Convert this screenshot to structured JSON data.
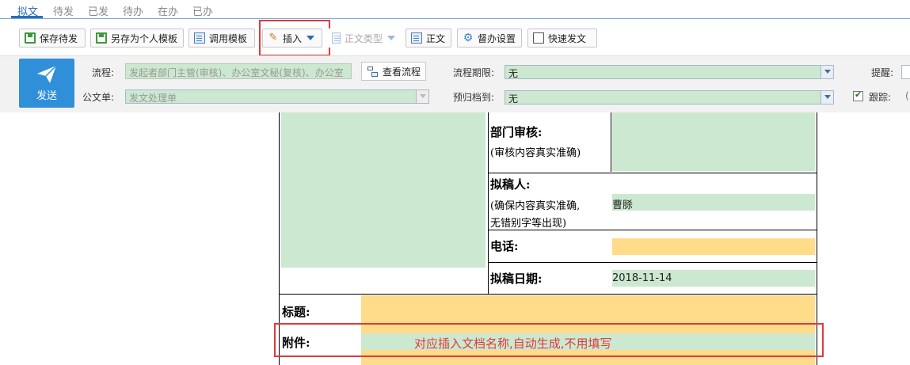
{
  "tabs": [
    "拟文",
    "待发",
    "已发",
    "待办",
    "在办",
    "已办"
  ],
  "toolbar": {
    "save_draft": "保存待发",
    "save_template": "另存为个人模板",
    "use_template": "调用模板",
    "insert": "插入",
    "body_type": "正文类型",
    "body": "正文",
    "supervise": "督办设置",
    "quick_send": "快速发文"
  },
  "form": {
    "send": "发送",
    "flow_label": "流程:",
    "flow_value": "发起者部门主管(审核)、办公室文秘(复核)、办公室",
    "view_flow": "查看流程",
    "deadline_label": "流程期限:",
    "deadline_value": "无",
    "remind_label": "提醒:",
    "doc_label": "公文单:",
    "doc_value": "发文处理单",
    "archive_label": "预归档到:",
    "archive_value": "无",
    "track_label": "跟踪:"
  },
  "document": {
    "dept_review": "部门审核:",
    "dept_review_note": "(审核内容真实准确)",
    "drafter": "拟稿人:",
    "drafter_note_1": "(确保内容真实准确,",
    "drafter_note_2": "无错别字等出现)",
    "drafter_value": "曹脎",
    "phone": "电话:",
    "draft_date": "拟稿日期:",
    "draft_date_value": "2018-11-14",
    "title": "标题:",
    "attachment": "附件:",
    "attachment_note": "对应插入文档名称,自动生成,不用填写"
  }
}
